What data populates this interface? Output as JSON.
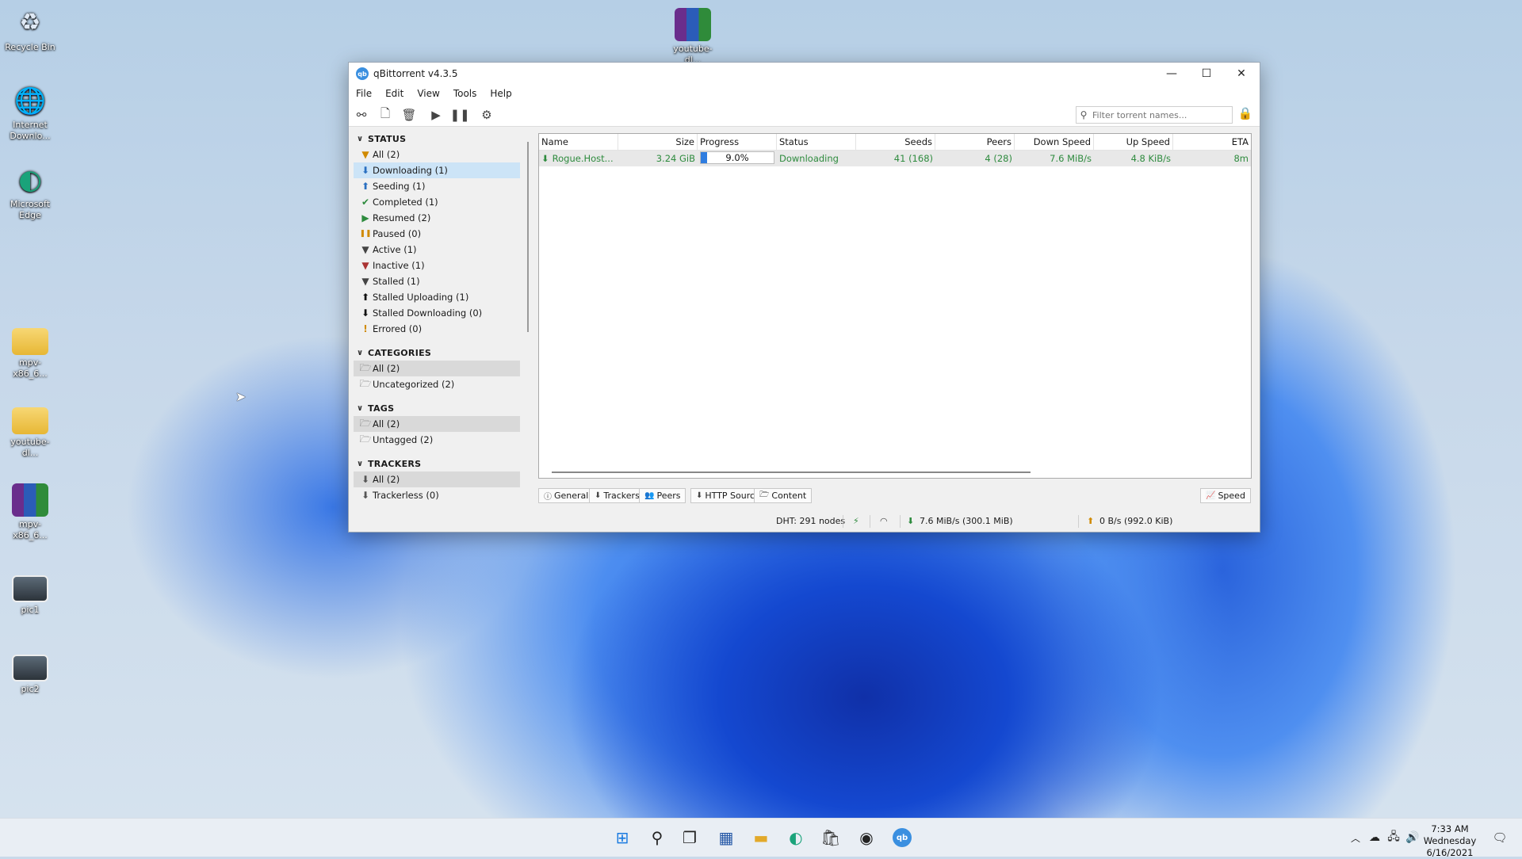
{
  "desktop": {
    "icons": [
      {
        "label": "Recycle Bin",
        "glyph": "♻"
      },
      {
        "label": "Internet Downlo...",
        "glyph": "🌐"
      },
      {
        "label": "Microsoft Edge",
        "glyph": "◐"
      },
      {
        "label": "mpv-x86_6...",
        "glyph": ""
      },
      {
        "label": "youtube-dl...",
        "glyph": ""
      },
      {
        "label": "mpv-x86_6...",
        "glyph": ""
      },
      {
        "label": "pic1",
        "glyph": ""
      },
      {
        "label": "pic2",
        "glyph": ""
      },
      {
        "label": "youtube-dl...",
        "glyph": ""
      }
    ]
  },
  "window": {
    "title": "qBittorrent v4.3.5",
    "app_icon": "qb",
    "controls": {
      "minimize": "—",
      "maximize": "☐",
      "close": "✕"
    }
  },
  "menu": [
    "File",
    "Edit",
    "View",
    "Tools",
    "Help"
  ],
  "toolbar": {
    "filter_placeholder": "Filter torrent names..."
  },
  "sidebar": {
    "status_header": "STATUS",
    "status": [
      {
        "label": "All (2)",
        "icon": "▼",
        "color": "#d08a00"
      },
      {
        "label": "Downloading (1)",
        "icon": "⬇",
        "color": "#2a6fc0"
      },
      {
        "label": "Seeding (1)",
        "icon": "⬆",
        "color": "#2a6fc0"
      },
      {
        "label": "Completed (1)",
        "icon": "✔",
        "color": "#2e8b3e"
      },
      {
        "label": "Resumed (2)",
        "icon": "▶",
        "color": "#2e8b3e"
      },
      {
        "label": "Paused (0)",
        "icon": "❚❚",
        "color": "#d08a00"
      },
      {
        "label": "Active (1)",
        "icon": "▼",
        "color": "#444"
      },
      {
        "label": "Inactive (1)",
        "icon": "▼",
        "color": "#a33"
      },
      {
        "label": "Stalled (1)",
        "icon": "▼",
        "color": "#444"
      },
      {
        "label": "Stalled Uploading (1)",
        "icon": "⬆",
        "color": "#111"
      },
      {
        "label": "Stalled Downloading (0)",
        "icon": "⬇",
        "color": "#111"
      },
      {
        "label": "Errored (0)",
        "icon": "!",
        "color": "#d08a00"
      }
    ],
    "categories_header": "CATEGORIES",
    "categories": [
      "All (2)",
      "Uncategorized (2)"
    ],
    "tags_header": "TAGS",
    "tags": [
      "All (2)",
      "Untagged (2)"
    ],
    "trackers_header": "TRACKERS",
    "trackers": [
      "All (2)",
      "Trackerless (0)"
    ]
  },
  "table": {
    "columns": [
      "Name",
      "Size",
      "Progress",
      "Status",
      "Seeds",
      "Peers",
      "Down Speed",
      "Up Speed",
      "ETA"
    ],
    "rows": [
      {
        "name": "Rogue.Host...",
        "size": "3.24 GiB",
        "progress_label": "9.0%",
        "progress": 0.09,
        "status": "Downloading",
        "seeds": "41 (168)",
        "peers": "4 (28)",
        "down_speed": "7.6 MiB/s",
        "up_speed": "4.8 KiB/s",
        "eta": "8m"
      }
    ]
  },
  "tabs": [
    "General",
    "Trackers",
    "Peers",
    "HTTP Sources",
    "Content"
  ],
  "speed_button": "Speed",
  "statusbar": {
    "dht": "DHT: 291 nodes",
    "download": "7.6 MiB/s (300.1 MiB)",
    "upload": "0 B/s (992.0 KiB)"
  },
  "taskbar": {
    "time": "7:33 AM",
    "day": "Wednesday",
    "date": "6/16/2021"
  }
}
